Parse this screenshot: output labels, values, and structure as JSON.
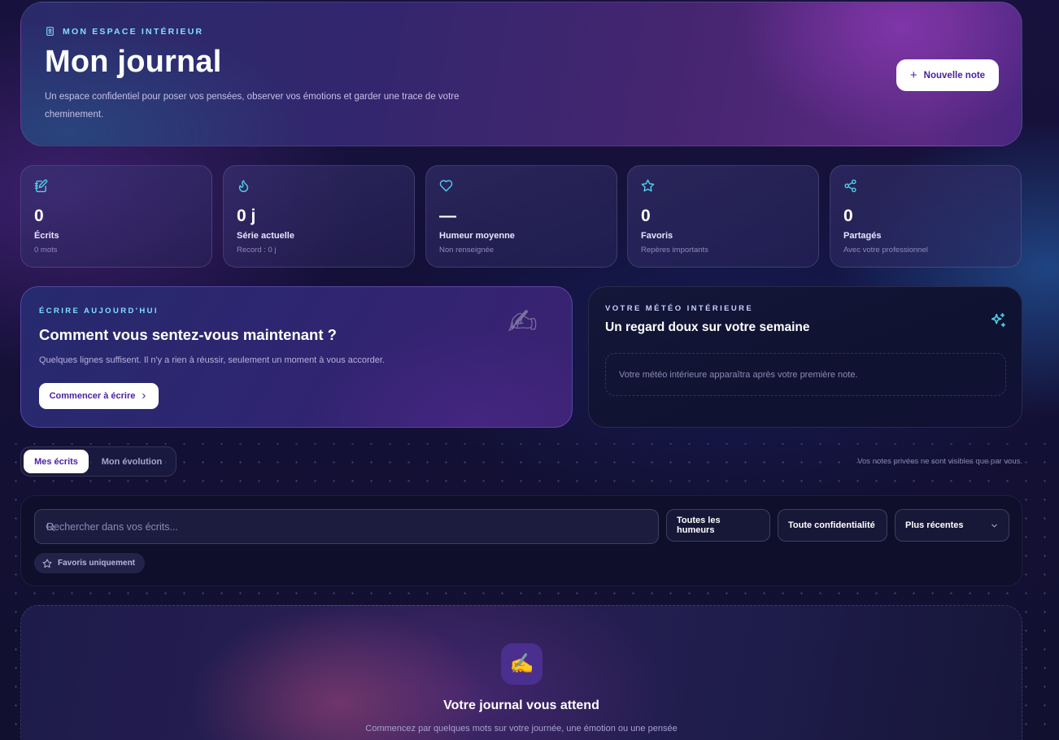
{
  "hero": {
    "eyebrow": "MON ESPACE INTÉRIEUR",
    "title": "Mon journal",
    "description": "Un espace confidentiel pour poser vos pensées, observer vos émotions et garder une trace de votre cheminement.",
    "new_note_label": "Nouvelle note"
  },
  "stats": [
    {
      "icon": "notebook-pen-icon",
      "value": "0",
      "label": "Écrits",
      "sub": "0 mots"
    },
    {
      "icon": "flame-icon",
      "value": "0 j",
      "label": "Série actuelle",
      "sub": "Record : 0 j"
    },
    {
      "icon": "heart-icon",
      "value": "—",
      "label": "Humeur moyenne",
      "sub": "Non renseignée"
    },
    {
      "icon": "star-icon",
      "value": "0",
      "label": "Favoris",
      "sub": "Repères importants"
    },
    {
      "icon": "share-icon",
      "value": "0",
      "label": "Partagés",
      "sub": "Avec votre professionnel"
    }
  ],
  "write_today": {
    "eyebrow": "ÉCRIRE AUJOURD'HUI",
    "title": "Comment vous sentez-vous maintenant ?",
    "description": "Quelques lignes suffisent. Il n'y a rien à réussir, seulement un moment à vous accorder.",
    "button_label": "Commencer à écrire",
    "decor_glyph": "✍"
  },
  "meteo": {
    "eyebrow": "VOTRE MÉTÉO INTÉRIEURE",
    "title": "Un regard doux sur votre semaine",
    "empty_text": "Votre météo intérieure apparaîtra après votre première note."
  },
  "tabs": {
    "active": "Mes écrits",
    "inactive": "Mon évolution"
  },
  "privacy_note": "Vos notes privées ne sont visibles que par vous.",
  "filters": {
    "search_placeholder": "Rechercher dans vos écrits...",
    "mood": "Toutes les humeurs",
    "privacy": "Toute confidentialité",
    "sort": "Plus récentes",
    "favorites_only": "Favoris uniquement"
  },
  "empty_state": {
    "icon_glyph": "✍️",
    "title": "Votre journal vous attend",
    "description": "Commencez par quelques mots sur votre journée, une émotion ou une pensée"
  },
  "colors": {
    "accent_cyan": "#7fe0ff",
    "accent_purple": "#4b1fa0",
    "icon_cyan": "#4fd1e8"
  }
}
